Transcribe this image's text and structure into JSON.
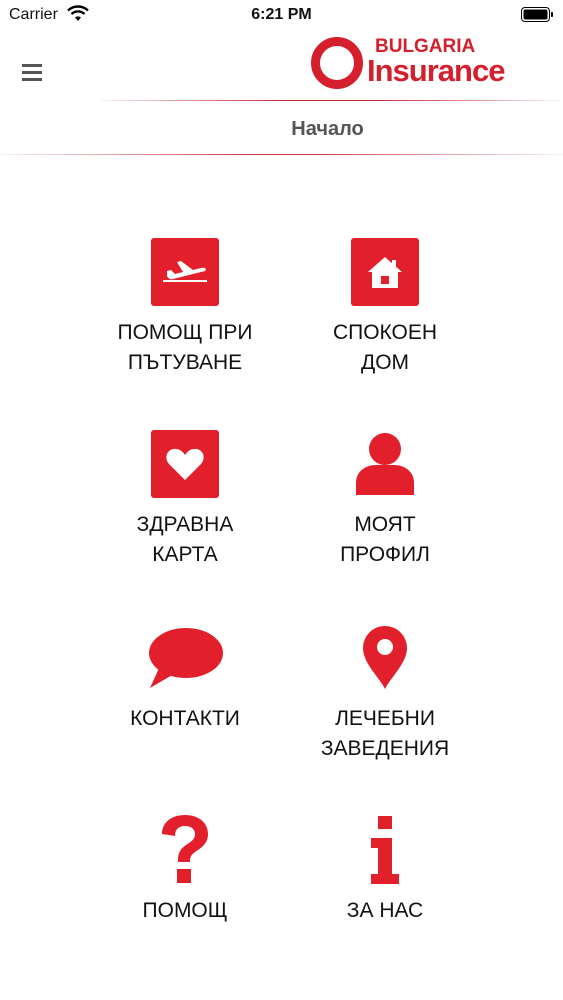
{
  "status_bar": {
    "carrier": "Carrier",
    "time": "6:21 PM"
  },
  "header": {
    "menu_icon": "hamburger-menu-icon",
    "logo_top": "BULGARIA",
    "logo_main": "Insurance",
    "page_title": "Начало"
  },
  "colors": {
    "brand_red": "#e2202c",
    "title_gray": "#555555"
  },
  "tiles": [
    {
      "icon": "airplane-icon",
      "label": "ПОМОЩ ПРИ\nПЪТУВАНЕ"
    },
    {
      "icon": "home-icon",
      "label": "СПОКОЕН\nДОМ"
    },
    {
      "icon": "heart-icon",
      "label": "ЗДРАВНА\nКАРТА"
    },
    {
      "icon": "user-profile-icon",
      "label": "МОЯТ\nПРОФИЛ"
    },
    {
      "icon": "speech-bubble-icon",
      "label": "КОНТАКТИ"
    },
    {
      "icon": "map-pin-icon",
      "label": "ЛЕЧЕБНИ\nЗАВЕДЕНИЯ"
    },
    {
      "icon": "question-mark-icon",
      "label": "ПОМОЩ"
    },
    {
      "icon": "info-icon",
      "label": "ЗА НАС"
    }
  ]
}
